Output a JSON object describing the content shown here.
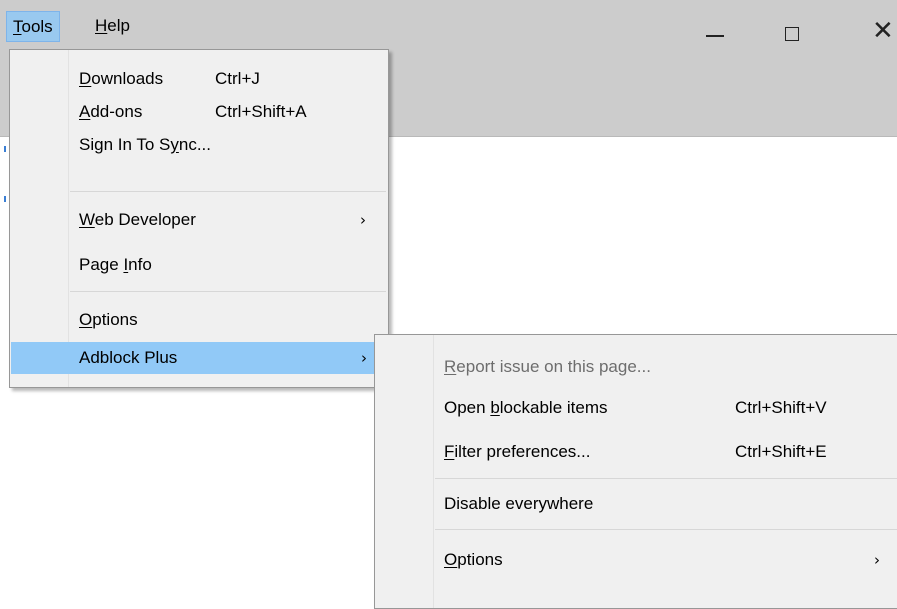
{
  "menubar": {
    "tools": {
      "mnemonic": "T",
      "rest": "ools"
    },
    "help": {
      "mnemonic": "H",
      "rest": "elp"
    }
  },
  "window_controls": {
    "minimize_icon": "minimize-icon",
    "maximize_icon": "maximize-icon",
    "close_icon": "close-icon",
    "close_glyph": "✕"
  },
  "tools_menu": {
    "downloads": {
      "mnemonic": "D",
      "rest": "ownloads",
      "accel": "Ctrl+J"
    },
    "addons": {
      "mnemonic": "A",
      "rest": "dd-ons",
      "accel": "Ctrl+Shift+A"
    },
    "sign_in": {
      "pre": "Sign In To S",
      "mnemonic": "y",
      "post": "nc..."
    },
    "web_developer": {
      "mnemonic": "W",
      "rest": "eb Developer",
      "arrow": "›"
    },
    "page_info": {
      "pre": "Page ",
      "mnemonic": "I",
      "post": "nfo"
    },
    "options": {
      "mnemonic": "O",
      "rest": "ptions"
    },
    "adblock_plus": {
      "label": "Adblock Plus",
      "arrow": "›"
    }
  },
  "adblock_submenu": {
    "report_issue": {
      "mnemonic": "R",
      "rest": "eport issue on this page..."
    },
    "open_blockable": {
      "pre": "Open ",
      "mnemonic": "b",
      "post": "lockable items",
      "accel": "Ctrl+Shift+V"
    },
    "filter_prefs": {
      "mnemonic": "F",
      "rest": "ilter preferences...",
      "accel": "Ctrl+Shift+E"
    },
    "disable_everywhere": {
      "label": "Disable everywhere"
    },
    "options": {
      "mnemonic": "O",
      "rest": "ptions",
      "arrow": "›"
    }
  }
}
